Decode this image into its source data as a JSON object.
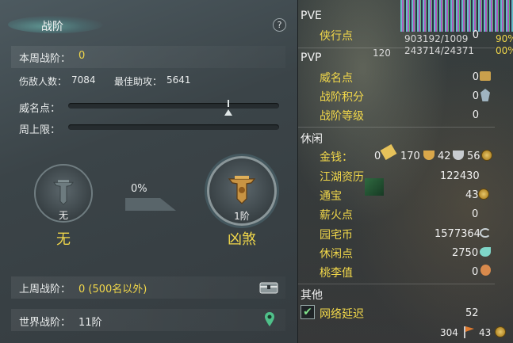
{
  "left": {
    "title": "战阶",
    "help": "?",
    "week_rank_label": "本周战阶：",
    "week_rank_value": "0",
    "injured_label": "伤敌人数：",
    "injured_value": "7084",
    "best_assist_label": "最佳助攻：",
    "best_assist_value": "5641",
    "prestige_label": "威名点：",
    "prestige_progress": 0.72,
    "week_cap_label": "周上限：",
    "week_cap_progress": 0,
    "current_rank_small": "无",
    "current_rank_name": "无",
    "progress_pct": "0%",
    "next_rank_small": "1阶",
    "next_rank_name": "凶煞",
    "last_week_label": "上周战阶：",
    "last_week_value": "0 (500名以外)",
    "world_rank_label": "世界战阶：",
    "world_rank_value": "11阶"
  },
  "hud": {
    "text1": "903192/1009",
    "text2": "243714/24371",
    "text3": "120",
    "pct1": "90%",
    "pct2": "00%"
  },
  "right": {
    "pve_header": "PVE",
    "pve_items": [
      {
        "label": "侠行点",
        "value": "0"
      }
    ],
    "pvp_header": "PVP",
    "pvp_items": [
      {
        "label": "威名点",
        "value": "0"
      },
      {
        "label": "战阶积分",
        "value": "0"
      },
      {
        "label": "战阶等级",
        "value": "0"
      }
    ],
    "leisure_header": "休闲",
    "gold_label": "金钱：",
    "gold_a": "0",
    "gold_b": "170",
    "gold_c": "42",
    "gold_d": "56",
    "leisure_items": [
      {
        "label": "江湖资历",
        "value": "122430"
      },
      {
        "label": "通宝",
        "value": "43"
      },
      {
        "label": "薪火点",
        "value": "0"
      },
      {
        "label": "园宅币",
        "value": "1577364"
      },
      {
        "label": "休闲点",
        "value": "2750"
      },
      {
        "label": "桃李值",
        "value": "0"
      }
    ],
    "other_header": "其他",
    "latency_label": "网络延迟",
    "latency_value": "52",
    "footer_a": "304",
    "footer_b": "43"
  }
}
